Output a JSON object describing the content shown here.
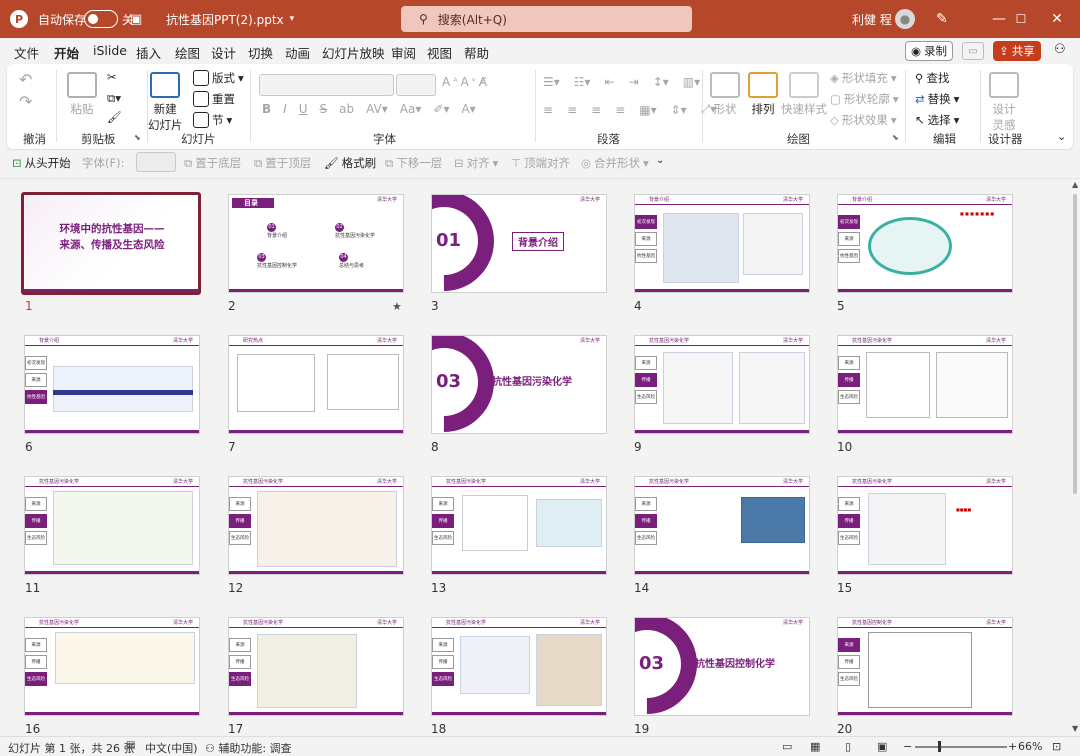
{
  "titlebar": {
    "logo": "P",
    "autosave_label": "自动保存",
    "autosave_state": "关",
    "filename": "抗性基因PPT(2).pptx",
    "search_placeholder": "搜索(Alt+Q)",
    "user_name": "利健 程"
  },
  "menu": {
    "tabs": [
      "文件",
      "开始",
      "iSlide",
      "插入",
      "绘图",
      "设计",
      "切换",
      "动画",
      "幻灯片放映",
      "审阅",
      "视图",
      "帮助"
    ],
    "record": "录制",
    "share": "共享"
  },
  "ribbon": {
    "groups": {
      "undo": "撤消",
      "clipboard": "剪贴板",
      "slides": "幻灯片",
      "font": "字体",
      "paragraph": "段落",
      "drawing": "绘图",
      "editing": "编辑",
      "designer": "设计器"
    },
    "paste": "粘贴",
    "new_slide": "新建\n幻灯片",
    "layout": "版式",
    "reset": "重置",
    "section": "节",
    "shapes": "形状",
    "arrange": "排列",
    "quick_styles": "快速样式",
    "shape_fill": "形状填充",
    "shape_outline": "形状轮廓",
    "shape_effects": "形状效果",
    "find": "查找",
    "replace": "替换",
    "select": "选择",
    "design_ideas": "设计\n灵感"
  },
  "toolbar2": {
    "from_start": "从头开始",
    "font_label": "字体(F):",
    "bring_back": "置于底层",
    "bring_front": "置于顶层",
    "format_painter": "格式刷",
    "move_down": "下移一层",
    "align": "对齐",
    "align_top": "顶端对齐",
    "merge_shapes": "合并形状"
  },
  "slides": [
    {
      "num": "1",
      "title": "环境中的抗性基因——\n来源、传播及生态风险"
    },
    {
      "num": "2",
      "title": "目录",
      "items": [
        "背景介绍",
        "抗性基因污染化学",
        "抗性基因控制化学",
        "总结与思考"
      ]
    },
    {
      "num": "3",
      "secnum": "01",
      "title": "背景介绍"
    },
    {
      "num": "4",
      "header": "背景介绍"
    },
    {
      "num": "5",
      "header": "背景介绍"
    },
    {
      "num": "6",
      "header": "背景介绍"
    },
    {
      "num": "7",
      "header": "研究热点"
    },
    {
      "num": "8",
      "secnum": "03",
      "title": "抗性基因污染化学"
    },
    {
      "num": "9",
      "header": "抗性基因污染化学"
    },
    {
      "num": "10",
      "header": "抗性基因污染化学"
    },
    {
      "num": "11",
      "header": "抗性基因污染化学"
    },
    {
      "num": "12",
      "header": "抗性基因污染化学"
    },
    {
      "num": "13",
      "header": "抗性基因污染化学"
    },
    {
      "num": "14",
      "header": "抗性基因污染化学"
    },
    {
      "num": "15",
      "header": "抗性基因污染化学"
    },
    {
      "num": "16",
      "header": "抗性基因污染化学"
    },
    {
      "num": "17",
      "header": "抗性基因污染化学"
    },
    {
      "num": "18",
      "header": "抗性基因污染化学"
    },
    {
      "num": "19",
      "secnum": "03",
      "title": "抗性基因控制化学"
    },
    {
      "num": "20",
      "header": "抗性基因控制化学"
    }
  ],
  "sidenav": {
    "a": [
      "来源",
      "传播",
      "生态风险"
    ],
    "b": [
      "初次发现",
      "来源",
      "抗性基因"
    ]
  },
  "crest": "清华大学",
  "statusbar": {
    "slide_info": "幻灯片 第 1 张，共 26 张",
    "language": "中文(中国)",
    "accessibility": "辅助功能: 调查",
    "zoom": "66%"
  }
}
